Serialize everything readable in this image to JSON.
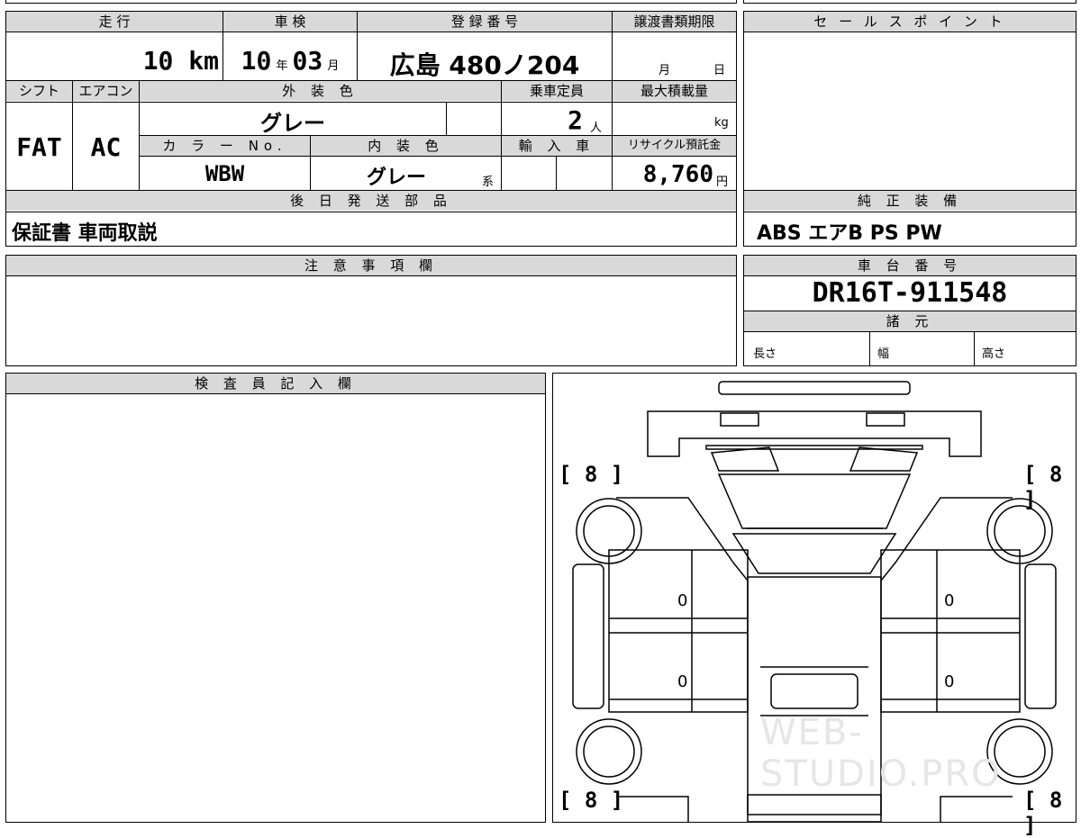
{
  "top_block": {
    "mileage_label": "走 行",
    "mileage_value": "10 km",
    "inspection_label": "車 検",
    "inspection_year": "10",
    "inspection_year_unit": "年",
    "inspection_month": "03",
    "inspection_month_unit": "月",
    "reg_label": "登 録 番 号",
    "reg_value": "広島 480ノ204",
    "transfer_label": "譲渡書類期限",
    "transfer_month_unit": "月",
    "transfer_day_unit": "日",
    "shift_label": "シフト",
    "ac_label": "エアコン",
    "exterior_label": "外 装 色",
    "capacity_label": "乗車定員",
    "maxload_label": "最大積載量",
    "shift_value": "FAT",
    "ac_value": "AC",
    "exterior_value": "グレー",
    "capacity_value": "2",
    "capacity_unit": "人",
    "maxload_unit": "kg",
    "color_no_label": "カ ラ ー No.",
    "interior_label": "内 装 色",
    "import_label": "輸 入 車",
    "recycle_label": "リサイクル預託金",
    "color_no_value": "WBW",
    "interior_value": "グレー",
    "interior_suffix": "系",
    "recycle_value": "8,760",
    "recycle_unit": "円",
    "later_parts_label": "後 日 発 送 部 品",
    "later_parts_value": "保証書 車両取説"
  },
  "sales_point": {
    "label": "セ ー ル ス ポ イ ン ト"
  },
  "genuine_equipment": {
    "label": "純 正 装 備",
    "value": "ABS エアB PS PW"
  },
  "notes": {
    "label": "注 意 事 項 欄"
  },
  "chassis": {
    "label": "車 台 番 号",
    "value": "DR16T-911548",
    "specs_label": "諸 元",
    "length_label": "長さ",
    "width_label": "幅",
    "height_label": "高さ"
  },
  "inspector": {
    "label": "検 査 員 記 入 欄"
  },
  "diagram": {
    "tl": "[ 8 ]",
    "tr": "[ 8 ]",
    "bl": "[ 8 ]",
    "br": "[ 8 ]",
    "m1": "0",
    "m2": "0",
    "m3": "0",
    "m4": "0",
    "watermark": "WEB-STUDIO.PRO"
  }
}
